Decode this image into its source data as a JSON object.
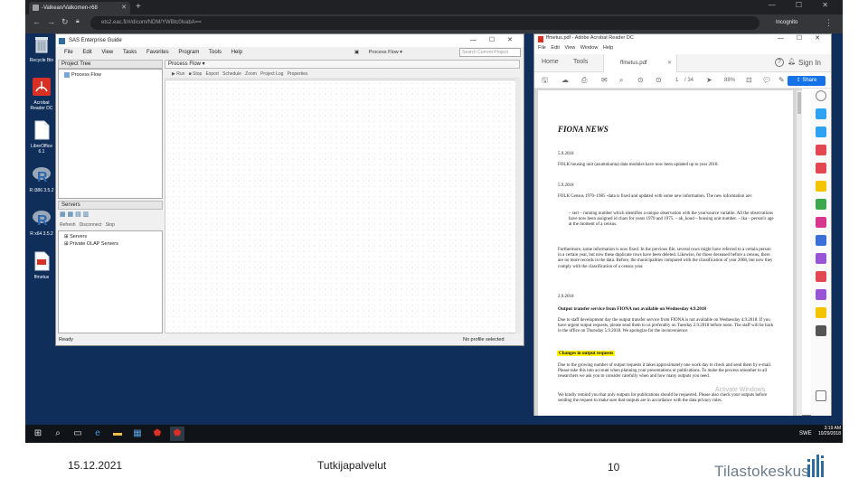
{
  "browser": {
    "tab_title": "-Valkean/Valkomen-r68",
    "url": "ets2.eac.fi/#/dicom/NDM/YWBtc0lvabA==",
    "profile_label": "Incognito",
    "new_tab_symbol": "+",
    "window_controls": "— ☐ ✕"
  },
  "desktop": {
    "icons": [
      {
        "label": "Recycle Bin",
        "icon": "recycle-bin-icon"
      },
      {
        "label": "Acrobat Reader DC",
        "icon": "acrobat-icon"
      },
      {
        "label": "LibreOffice 6.1",
        "icon": "libreoffice-icon"
      },
      {
        "label": "R i386 3.5.2",
        "icon": "r-icon"
      },
      {
        "label": "R x64 3.5.2",
        "icon": "r-icon"
      },
      {
        "label": "ffmetus",
        "icon": "pdf-file-icon"
      }
    ]
  },
  "sas": {
    "title": "SAS Enterprise Guide",
    "menu": [
      "File",
      "Edit",
      "View",
      "Tasks",
      "Favorites",
      "Program",
      "Tools",
      "Help"
    ],
    "process_flow_btn": "Process Flow",
    "search_placeholder": "Search Current Project",
    "project_tree_label": "Project Tree",
    "tree_item": "Process Flow",
    "process_flow_tab": "Process Flow",
    "flow_toolbar": [
      "Run",
      "Stop",
      "Export",
      "Schedule",
      "Zoom",
      "Project Log",
      "Properties"
    ],
    "servers_label": "Servers",
    "servers_toolbar": [
      "Refresh",
      "Disconnect",
      "Stop"
    ],
    "servers_items": [
      "Servers",
      "Private OLAP Servers"
    ],
    "status_left": "Ready",
    "status_right": "No profile selected"
  },
  "acrobat": {
    "title": "ffmetus.pdf - Adobe Acrobat Reader DC",
    "menu": [
      "File",
      "Edit",
      "View",
      "Window",
      "Help"
    ],
    "tabs": [
      "Home",
      "Tools",
      "ffmetus.pdf"
    ],
    "sign_in": "Sign In",
    "share": "Share",
    "page_num": "1",
    "page_total": "/ 34",
    "zoom": "88%"
  },
  "pdf": {
    "heading": "FIONA NEWS",
    "sections": [
      {
        "date": "5.9.2018",
        "text": "FOLK housing unit (asuntokunta) data modules have now been updated up to year 2018."
      },
      {
        "date": "5.9.2018",
        "text": "FOLK Census 1970–1985 -data is fixed and updated with some new information. The new information are:"
      },
      {
        "date": "",
        "text": "– sert – running number which identifies a unique observation with the year/source variable. All the observations have now been assigned id chars for years 1970 and 1975. – ak_kood – housing unit number. – ika – person's age at the moment of a census."
      },
      {
        "date": "",
        "text": "Furthermore, some information is now fixed. In the previous file, several rows might have referred to a certain person in a certain year, but now these duplicate rows have been deleted. Likewise, for those deceased before a census, there are no more records in the data. Before, the municipalities compared with the classification of year 2008, but now they comply with the classification of a census year."
      },
      {
        "date": "2.9.2018",
        "text": ""
      }
    ],
    "bold1": "Output transfer service from FIONA not available on Wednesday 4.9.2018",
    "para1": "Due to staff development day the output transfer service from FIONA is not available on Wednesday 4.9.2018. If you have urgent output requests, please send them to us preferably on Tuesday 2.9.2018 before noon. The staff will be back in the office on Thursday 5.9.2018. We apologize for the inconvenience.",
    "highlight": "Changes in output requests",
    "para2": "Due to the growing number of output requests it takes approximately one work day to check and send them by e-mail. Please take this into account when planning your presentations or publications. To make the process smoother to all researchers we ask you to consider carefully when and how many outputs you need.",
    "para3": "We kindly remind you that only outputs for publications should be requested. Please also check your outputs before sending the request to make sure that outputs are in accordance with the data privacy rules.",
    "watermark": "Activate Windows"
  },
  "taskbar": {
    "lang": "SWE",
    "time": "3:19 AM",
    "date": "10/29/2018"
  },
  "footer": {
    "date": "15.12.2021",
    "center": "Tutkijapalvelut",
    "page": "10",
    "logo": "Tilastokeskus"
  },
  "colors": {
    "desktop": "#0f2f5a",
    "acrobat_red": "#d93025",
    "share_blue": "#1473e6",
    "highlight": "#fff200",
    "logo_gray": "#6b7c8c",
    "logo_blue": "#2f6c9e"
  }
}
